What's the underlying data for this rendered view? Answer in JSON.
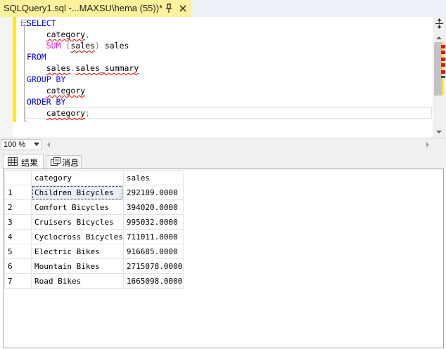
{
  "tab": {
    "title": "SQLQuery1.sql -...MAXSU\\hema (55))*",
    "pin_icon": "pin-icon",
    "close_icon": "close-icon"
  },
  "editor": {
    "lines": [
      [
        {
          "t": "SELECT",
          "c": "kw"
        }
      ],
      [
        {
          "t": "    "
        },
        {
          "t": "category",
          "c": "sq"
        },
        {
          "t": ",",
          "c": "gr"
        }
      ],
      [
        {
          "t": "    "
        },
        {
          "t": "SUM",
          "c": "fn"
        },
        {
          "t": " (",
          "c": "gr"
        },
        {
          "t": "sales",
          "c": "sq"
        },
        {
          "t": ")",
          "c": "gr"
        },
        {
          "t": " sales"
        }
      ],
      [
        {
          "t": "FROM",
          "c": "kw"
        }
      ],
      [
        {
          "t": "    "
        },
        {
          "t": "sales",
          "c": "sq"
        },
        {
          "t": ".",
          "c": "gr"
        },
        {
          "t": "sales_summary",
          "c": "sq"
        }
      ],
      [
        {
          "t": "GROUP BY",
          "c": "kw"
        }
      ],
      [
        {
          "t": "    "
        },
        {
          "t": "category",
          "c": "sq"
        }
      ],
      [
        {
          "t": "ORDER BY",
          "c": "kw"
        }
      ],
      [
        {
          "t": "    "
        },
        {
          "t": "category",
          "c": "sq"
        },
        {
          "t": ";",
          "c": "gr"
        }
      ]
    ]
  },
  "zoom": {
    "label": "100 %"
  },
  "results_tabs": [
    {
      "label": "结果",
      "icon": "grid-icon"
    },
    {
      "label": "消息",
      "icon": "messages-icon"
    }
  ],
  "grid": {
    "columns": [
      "category",
      "sales"
    ],
    "rows": [
      {
        "n": "1",
        "category": "Children Bicycles",
        "sales": "292189.0000"
      },
      {
        "n": "2",
        "category": "Comfort Bicycles",
        "sales": "394020.0000"
      },
      {
        "n": "3",
        "category": "Cruisers Bicycles",
        "sales": "995032.0000"
      },
      {
        "n": "4",
        "category": "Cyclocross Bicycles",
        "sales": "711011.0000"
      },
      {
        "n": "5",
        "category": "Electric Bikes",
        "sales": "916685.0000"
      },
      {
        "n": "6",
        "category": "Mountain Bikes",
        "sales": "2715078.0000"
      },
      {
        "n": "7",
        "category": "Road Bikes",
        "sales": "1665098.0000"
      }
    ]
  },
  "colors": {
    "keyword": "#0000ff",
    "function": "#ff00ff",
    "tab_active": "#fff29d",
    "margin_changed": "#fde92c"
  }
}
